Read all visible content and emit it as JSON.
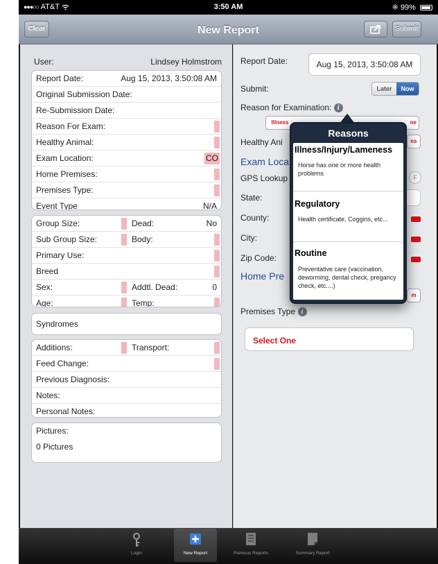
{
  "status_bar": {
    "carrier": "AT&T",
    "time": "3:50 AM",
    "battery": "99%"
  },
  "nav": {
    "title": "New Report",
    "clear": "Clear",
    "submit": "Submit"
  },
  "left": {
    "user_label": "User:",
    "user_value": "Lindsey Holmstrom",
    "g1": [
      {
        "label": "Report Date:",
        "value": "Aug 15, 2013, 3:50:08 AM"
      },
      {
        "label": "Original Submission Date:",
        "value": ""
      },
      {
        "label": "Re-Submission Date:",
        "value": ""
      },
      {
        "label": "Reason For Exam:",
        "value": ""
      },
      {
        "label": "Healthy Animal:",
        "value": ""
      },
      {
        "label": "Exam Location:",
        "value": "CO"
      },
      {
        "label": "Home Premises:",
        "value": ""
      },
      {
        "label": "Premises Type:",
        "value": ""
      },
      {
        "label": "Event Type",
        "value": "N/A"
      }
    ],
    "g2": {
      "group_size": "Group Size:",
      "dead": "Dead:",
      "dead_value": "No",
      "sub_group_size": "Sub Group Size:",
      "body": "Body:",
      "primary_use": "Primary Use:",
      "breed": "Breed",
      "sex": "Sex:",
      "addtl_dead": "Addtl. Dead:",
      "addtl_dead_value": "0",
      "age": "Age:",
      "temp": "Temp:"
    },
    "syndromes": "Syndromes",
    "g4": {
      "additions": "Additions:",
      "transport": "Transport:",
      "feed_change": "Feed Change:",
      "previous_diagnosis": "Previous Diagnosis:",
      "notes": "Notes:",
      "personal_notes": "Personal Notes:"
    },
    "pictures": {
      "label": "Pictures:",
      "count": "0 Pictures"
    }
  },
  "right": {
    "report_date_label": "Report Date:",
    "report_date_value": "Aug 15, 2013, 3:50:08 AM",
    "submit_label": "Submit:",
    "later": "Later",
    "now": "Now",
    "reason_label": "Reason for Examination:",
    "reason_seg_left": "Illness",
    "reason_seg_right": "ne",
    "healthy_animal": "Healthy Ani",
    "healthy_seg": "es",
    "exam_location_heading": "Exam Loca",
    "gps_lookup": "GPS Lookup",
    "gps_toggle": "F",
    "state": "State:",
    "county": "County:",
    "city": "City:",
    "zip_code": "Zip Code:",
    "home_premises_heading": "Home Pre",
    "home_seg": "m",
    "premises_type_label": "Premises Type",
    "select_one": "Select One"
  },
  "popover": {
    "title": "Reasons",
    "items": [
      {
        "title": "Illness/Injury/Lameness",
        "desc": "Horse has one or more health problems"
      },
      {
        "title": "Regulatory",
        "desc": "Health certificate, Coggins, etc..."
      },
      {
        "title": "Routine",
        "desc": "Preventative care (vaccination, deworming, dental check, pregancy check, etc....)"
      }
    ]
  },
  "tabs": [
    {
      "label": "Login"
    },
    {
      "label": "New Report"
    },
    {
      "label": "Previous Reports"
    },
    {
      "label": "Summary Report"
    }
  ],
  "colors": {
    "accent": "#2f64a8",
    "required": "#f3b6bd",
    "error": "#d4111f",
    "heading_blue": "#1f4a9a"
  }
}
